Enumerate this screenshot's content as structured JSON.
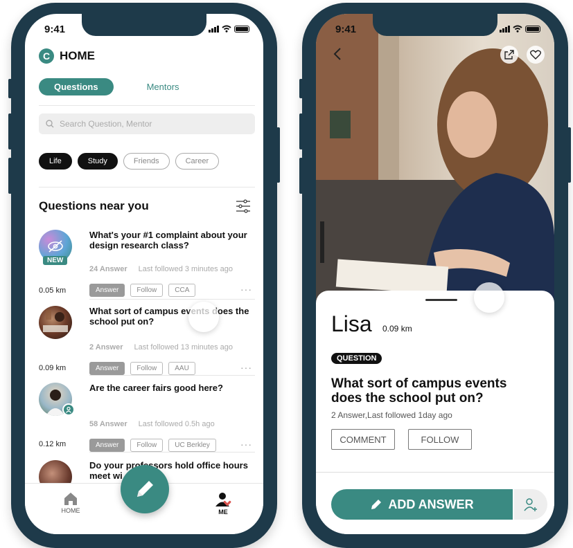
{
  "status_bar": {
    "time": "9:41"
  },
  "home": {
    "logo_letter": "C",
    "title": "HOME",
    "tabs": [
      {
        "label": "Questions",
        "active": true
      },
      {
        "label": "Mentors",
        "active": false
      }
    ],
    "search_placeholder": "Search Question, Mentor",
    "filters": [
      {
        "label": "Life",
        "selected": true
      },
      {
        "label": "Study",
        "selected": true
      },
      {
        "label": "Friends",
        "selected": false
      },
      {
        "label": "Career",
        "selected": false
      }
    ],
    "section_title": "Questions near you",
    "questions": [
      {
        "text": "What's your #1 complaint about your design research class?",
        "answers": "24 Answer",
        "followed": "Last followed 3 minutes ago",
        "distance": "0.05 km",
        "tag": "CCA",
        "badge": "NEW"
      },
      {
        "text": "What sort of campus events does the school put on?",
        "answers": "2 Answer",
        "followed": "Last followed 13 minutes ago",
        "distance": "0.09 km",
        "tag": "AAU"
      },
      {
        "text": "Are the career fairs good here?",
        "answers": "58 Answer",
        "followed": "Last followed 0.5h ago",
        "distance": "0.12 km",
        "tag": "UC Berkley"
      },
      {
        "text": "Do your professors hold office hours meet wi"
      }
    ],
    "answer_label": "Answer",
    "follow_label": "Follow",
    "more_label": "···",
    "nav": {
      "home": "HOME",
      "me": "ME"
    }
  },
  "detail": {
    "name": "Lisa",
    "distance": "0.09 km",
    "badge": "QUESTION",
    "question": "What sort of campus events does the school put on?",
    "meta": "2 Answer,Last followed 1day ago",
    "comment_label": "COMMENT",
    "follow_label": "FOLLOW",
    "add_answer_label": "ADD ANSWER"
  },
  "colors": {
    "brand": "#3a8a82",
    "frame": "#1e3a4a"
  },
  "icons": [
    "home-icon",
    "me-icon",
    "pencil-icon",
    "search-icon",
    "filter-icon",
    "back-icon",
    "share-icon",
    "heart-icon",
    "add-person-icon"
  ]
}
